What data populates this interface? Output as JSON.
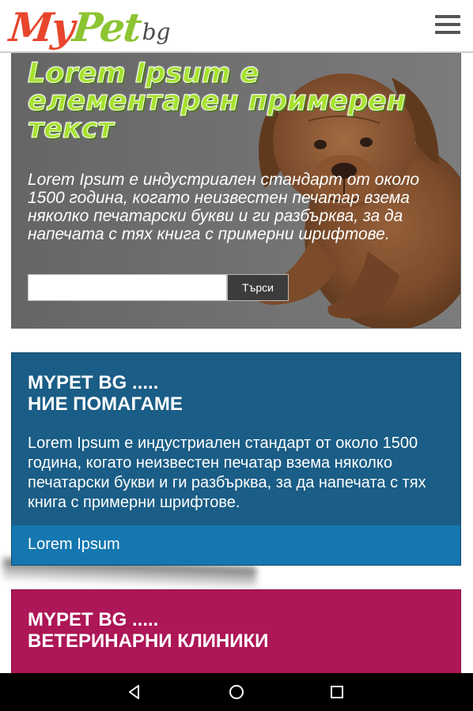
{
  "header": {
    "logo": {
      "my": "My",
      "pet": "Pet",
      "bg": "bg"
    },
    "menu_icon": "hamburger-menu-icon"
  },
  "hero": {
    "title": "Lorem Ipsum е елементарен примерен текст",
    "text": "Lorem Ipsum е индустриален стандарт от около 1500 година, когато неизвестен печатар взема няколко печатарски букви и ги разбърква, за да напечата с тях книга с примерни шрифтове.",
    "search_placeholder": "",
    "search_button": "Търси",
    "image": "puppy-image"
  },
  "card_help": {
    "title_line1": "MYPET BG .....",
    "title_line2": "НИЕ ПОМАГАМЕ",
    "text": "Lorem Ipsum е индустриален стандарт от около 1500 година, когато неизвестен печатар взема няколко печатарски букви и ги разбърква, за да напечата с тях книга с примерни шрифтове.",
    "link": "Lorem Ipsum",
    "color": "#1a5d86",
    "link_bar_color": "#1577b0"
  },
  "card_clinics": {
    "title_line1": "MYPET BG .....",
    "title_line2": "ВЕТЕРИНАРНИ КЛИНИКИ",
    "color": "#ad1657"
  },
  "navbar": {
    "back_icon": "back-triangle-icon",
    "home_icon": "home-circle-icon",
    "recents_icon": "recents-square-icon"
  },
  "colors": {
    "logo_red": "#e8462c",
    "logo_green": "#8cc432",
    "hero_title": "#a6e22e"
  }
}
